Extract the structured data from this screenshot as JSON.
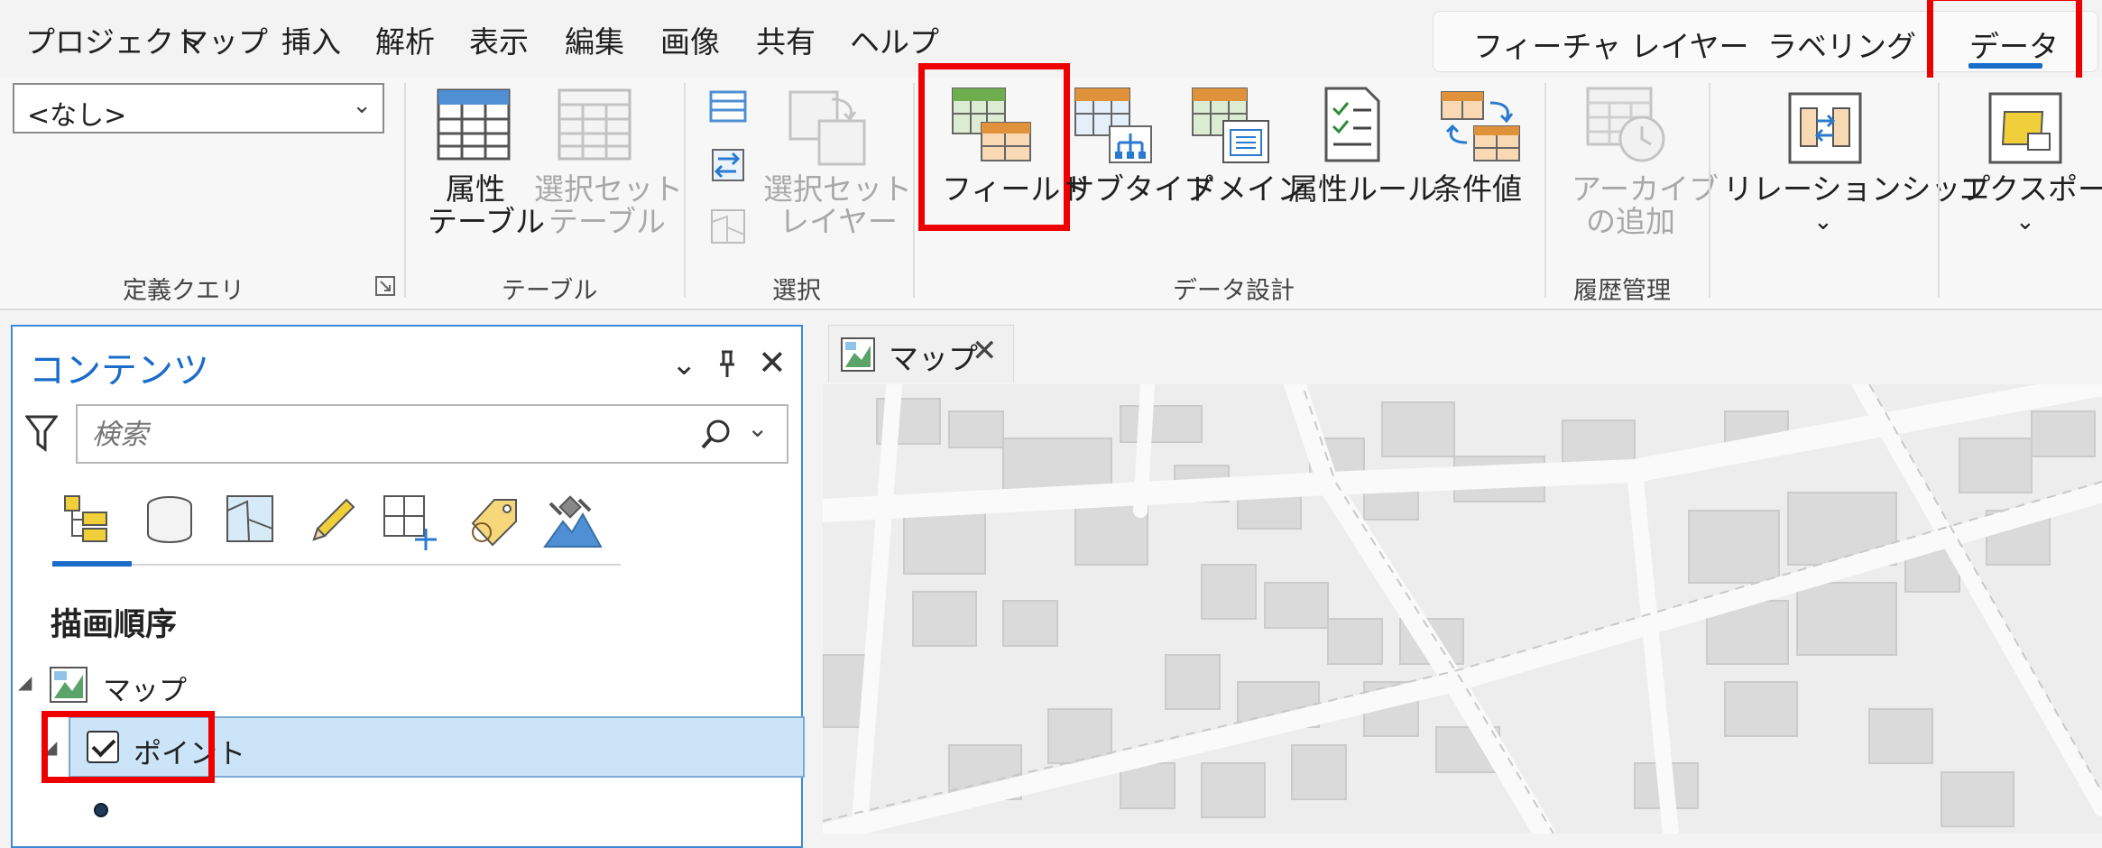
{
  "ribbon_tabs": [
    "プロジェクト",
    "マップ",
    "挿入",
    "解析",
    "表示",
    "編集",
    "画像",
    "共有",
    "ヘルプ"
  ],
  "context_tabs": [
    "フィーチャ レイヤー",
    "ラベリング",
    "データ"
  ],
  "active_tab": "データ",
  "definition_query": {
    "selected": "<なし>",
    "group_label": "定義クエリ"
  },
  "groups": {
    "table": "テーブル",
    "selection": "選択",
    "data_design": "データ設計",
    "archive": "履歴管理"
  },
  "buttons": {
    "attribute_table": [
      "属性",
      "テーブル"
    ],
    "selection_set_table": [
      "選択セット",
      "テーブル"
    ],
    "selection_set_layer": [
      "選択セット",
      "レイヤー"
    ],
    "fields": "フィールド",
    "subtypes": "サブタイプ",
    "domains": "ドメイン",
    "attribute_rules": "属性ルール",
    "contingent_values": "条件値",
    "add_archive": [
      "アーカイブ",
      "の追加"
    ],
    "relationships": "リレーションシップ",
    "export": "エクスポート"
  },
  "contents_pane": {
    "title": "コンテンツ",
    "search_placeholder": "検索",
    "section": "描画順序",
    "map_name": "マップ",
    "layer_name": "ポイント"
  },
  "map_tab": {
    "label": "マップ",
    "close": "✕"
  },
  "colors": {
    "accent": "#1a6cc9",
    "highlight_box": "#ee0000",
    "selected_row": "#cce4f7"
  }
}
